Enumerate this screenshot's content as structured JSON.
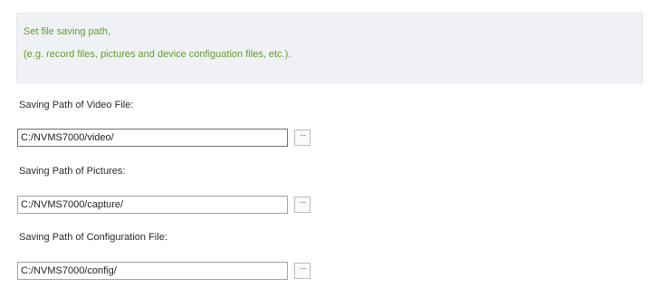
{
  "info": {
    "line1": "Set file saving path,",
    "line2": "(e.g. record files, pictures and device configuation files, etc.)."
  },
  "video": {
    "label": "Saving Path of Video File:",
    "value": "C:/NVMS7000/video/",
    "browse_label": "···",
    "browse_icon": "ellipsis-icon"
  },
  "pictures": {
    "label": "Saving Path of Pictures:",
    "value": "C:/NVMS7000/capture/",
    "browse_label": "···",
    "browse_icon": "ellipsis-icon"
  },
  "config": {
    "label": "Saving Path of Configuration File:",
    "value": "C:/NVMS7000/config/",
    "browse_label": "···",
    "browse_icon": "ellipsis-icon"
  },
  "colors": {
    "hint_text": "#6a9a32",
    "panel_background": "#eff1f4"
  }
}
